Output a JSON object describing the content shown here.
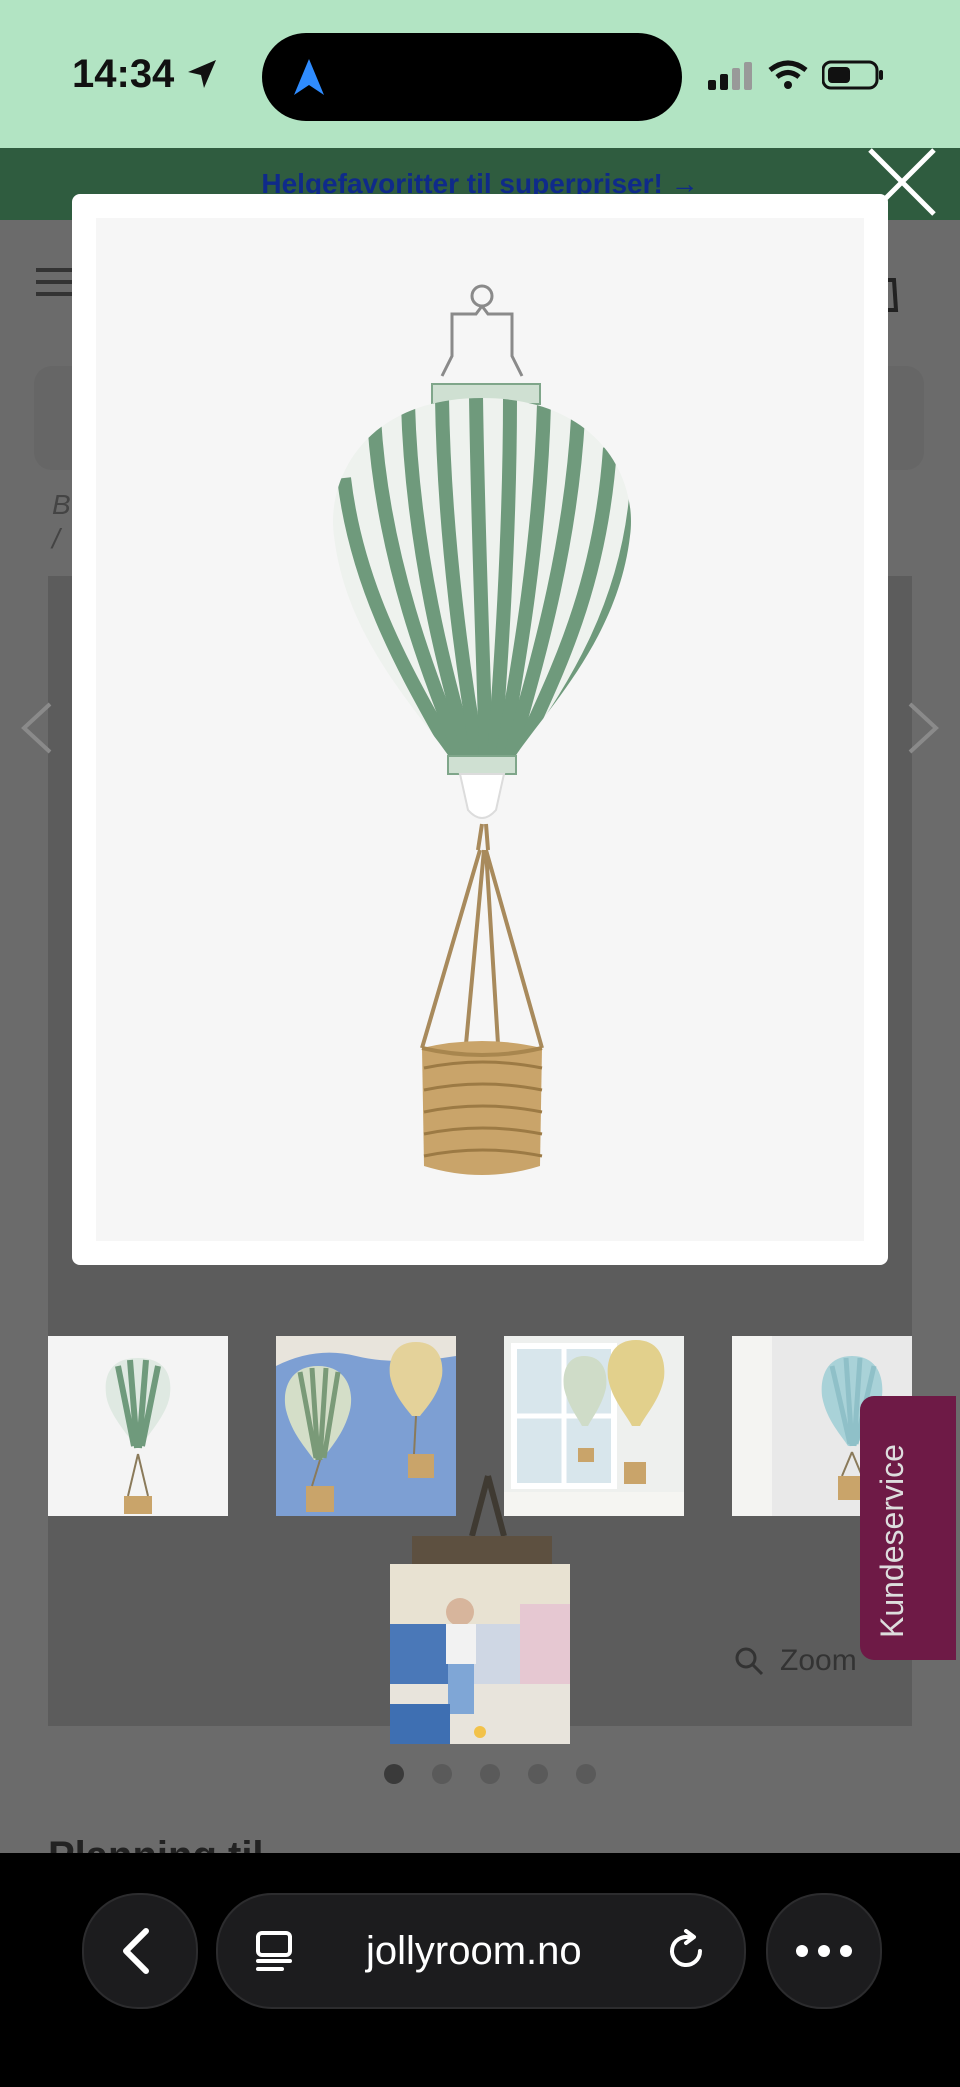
{
  "status_bar": {
    "time": "14:34"
  },
  "promo_banner": {
    "text": "Helgefavoritter til superpriser! →"
  },
  "page": {
    "breadcrumb_line1": "B",
    "breadcrumb_line2": "/",
    "zoom_label": "Zoom",
    "section_heading": "Planning til",
    "customer_service_tab": "Kundeservice",
    "gallery": {
      "thumbnails": [
        {
          "name": "green-striped-balloon-product"
        },
        {
          "name": "balloons-on-blue-wall"
        },
        {
          "name": "balloons-by-window"
        },
        {
          "name": "blue-balloon-hanging"
        },
        {
          "name": "child-in-room"
        }
      ],
      "dots_count": 5,
      "active_dot": 1
    }
  },
  "modal": {
    "image_name": "green-striped-hot-air-balloon-lamp"
  },
  "browser": {
    "url": "jollyroom.no"
  },
  "colors": {
    "status_bar_bg": "#b2e4c3",
    "promo_bg": "#2f5c3f",
    "promo_text": "#0f2a8a",
    "overlay": "#6b6b6b",
    "customer_service": "#6e1a46",
    "balloon_stripe": "#6f9a7c"
  },
  "icons": [
    "location-arrow-icon",
    "nav-arrow-icon",
    "signal-icon",
    "wifi-icon",
    "battery-icon",
    "close-icon",
    "menu-icon",
    "cart-icon",
    "chevron-left-icon",
    "chevron-right-icon",
    "search-icon",
    "tabs-icon",
    "reload-icon",
    "more-icon"
  ]
}
